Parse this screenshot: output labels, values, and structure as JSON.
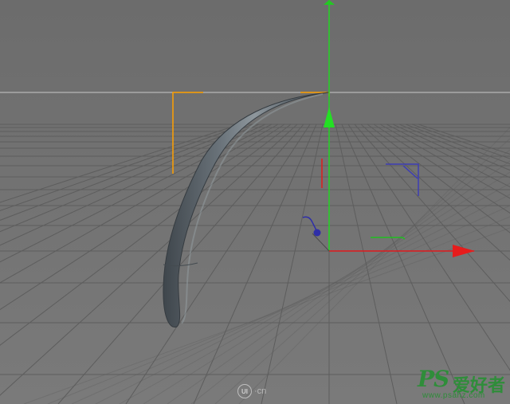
{
  "viewport": {
    "background_top": "#6d6d6d",
    "background_floor": "#7b7b7b",
    "horizon_color": "#c9c9c9",
    "grid_color": "#5c5c5c"
  },
  "axes": {
    "x_color": "#e0181c",
    "y_color": "#1fd61f",
    "z_color": "#3a3aae"
  },
  "object": {
    "name": "curved-horn-tube",
    "color": "#707880"
  },
  "selection_bracket_color": "#ffa000",
  "watermarks": {
    "ui_logo": "UI",
    "ui_suffix": "·cn",
    "ps_logo": "PS",
    "ps_chinese": "爱好者",
    "ps_url": "www.psahz.com"
  }
}
